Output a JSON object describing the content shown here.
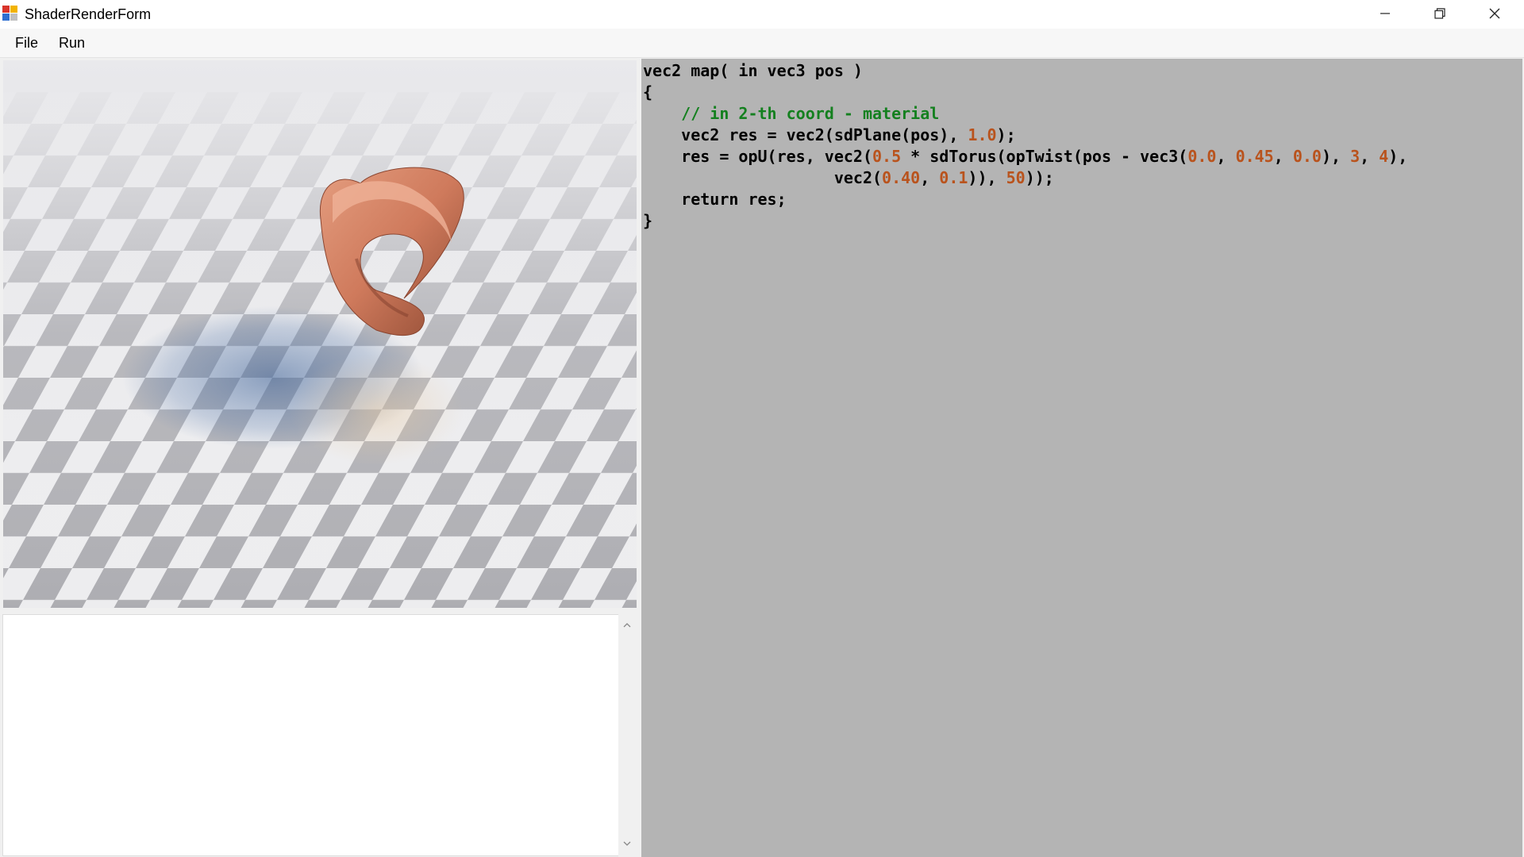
{
  "window": {
    "title": "ShaderRenderForm"
  },
  "menu": {
    "items": [
      {
        "label": "File"
      },
      {
        "label": "Run"
      }
    ]
  },
  "viewport": {
    "object_color": "#cf7a5c",
    "floor_light": "#f2f2f4",
    "floor_dark": "#a9a9ad"
  },
  "output": {
    "text": ""
  },
  "editor": {
    "background": "#b4b4b4",
    "lines": [
      [
        {
          "t": "vec2 map( in vec3 pos )",
          "c": "kw"
        }
      ],
      [
        {
          "t": "{",
          "c": "kw"
        }
      ],
      [
        {
          "t": "    // in 2-th coord - material",
          "c": "cm"
        }
      ],
      [
        {
          "t": "    vec2 res = vec2(sdPlane(pos), ",
          "c": "kw"
        },
        {
          "t": "1.0",
          "c": "num"
        },
        {
          "t": ");",
          "c": "kw"
        }
      ],
      [
        {
          "t": "    res = opU(res, vec2(",
          "c": "kw"
        },
        {
          "t": "0.5",
          "c": "num"
        },
        {
          "t": " * sdTorus(opTwist(pos - vec3(",
          "c": "kw"
        },
        {
          "t": "0.0",
          "c": "num"
        },
        {
          "t": ", ",
          "c": "kw"
        },
        {
          "t": "0.45",
          "c": "num"
        },
        {
          "t": ", ",
          "c": "kw"
        },
        {
          "t": "0.0",
          "c": "num"
        },
        {
          "t": "), ",
          "c": "kw"
        },
        {
          "t": "3",
          "c": "num"
        },
        {
          "t": ", ",
          "c": "kw"
        },
        {
          "t": "4",
          "c": "num"
        },
        {
          "t": "),",
          "c": "kw"
        }
      ],
      [
        {
          "t": "                    vec2(",
          "c": "kw"
        },
        {
          "t": "0.40",
          "c": "num"
        },
        {
          "t": ", ",
          "c": "kw"
        },
        {
          "t": "0.1",
          "c": "num"
        },
        {
          "t": ")), ",
          "c": "kw"
        },
        {
          "t": "50",
          "c": "num"
        },
        {
          "t": "));",
          "c": "kw"
        }
      ],
      [
        {
          "t": "    return res;",
          "c": "kw"
        }
      ],
      [
        {
          "t": "}",
          "c": "kw"
        }
      ]
    ]
  }
}
